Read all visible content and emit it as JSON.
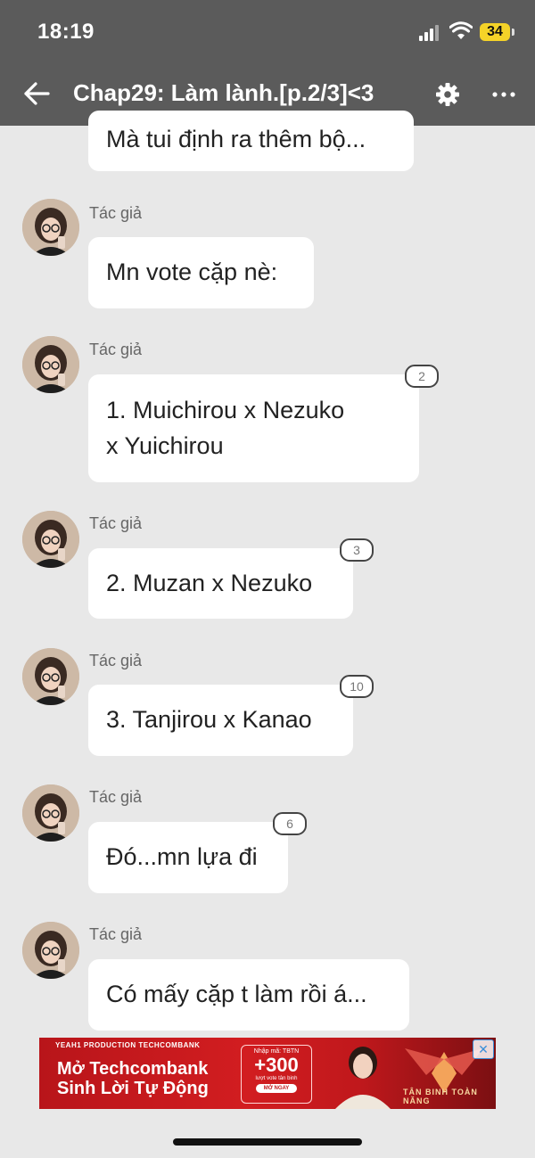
{
  "status": {
    "time": "18:19",
    "battery": "34"
  },
  "nav": {
    "title": "Chap29: Làm lành.[p.2/3]<3"
  },
  "messages": [
    {
      "text": "Mà tui định ra thêm bộ..."
    },
    {
      "author": "Tác giả",
      "text": "Mn vote cặp nè:"
    },
    {
      "author": "Tác giả",
      "text_line1": "1. Muichirou x Nezuko",
      "text_line2": "x Yuichirou",
      "comments": "2"
    },
    {
      "author": "Tác giả",
      "text": "2. Muzan x Nezuko",
      "comments": "3"
    },
    {
      "author": "Tác giả",
      "text": "3. Tanjirou x Kanao",
      "comments": "10"
    },
    {
      "author": "Tác giả",
      "text": "Đó...mn lựa đi",
      "comments": "6"
    },
    {
      "author": "Tác giả",
      "text": "Có mấy cặp t làm rồi á..."
    }
  ],
  "ad": {
    "top_line": "YEAH1  PRODUCTION  TECHCOMBANK",
    "headline_1": "Mở Techcombank",
    "headline_2": "Sinh Lời Tự Động",
    "promo_code": "Nhập mã: TBTN",
    "promo_value": "+300",
    "promo_sub": "lượt vote tân binh",
    "promo_cta": "MỞ NGAY",
    "logo_text": "TÂN BINH TOÀN NĂNG",
    "close_icon": "ad-choices-icon"
  },
  "colors": {
    "topbar": "#5b5b5b",
    "background": "#e8e8e8",
    "bubble": "#ffffff",
    "battery": "#f5d328",
    "ad_red": "#c0181c"
  }
}
